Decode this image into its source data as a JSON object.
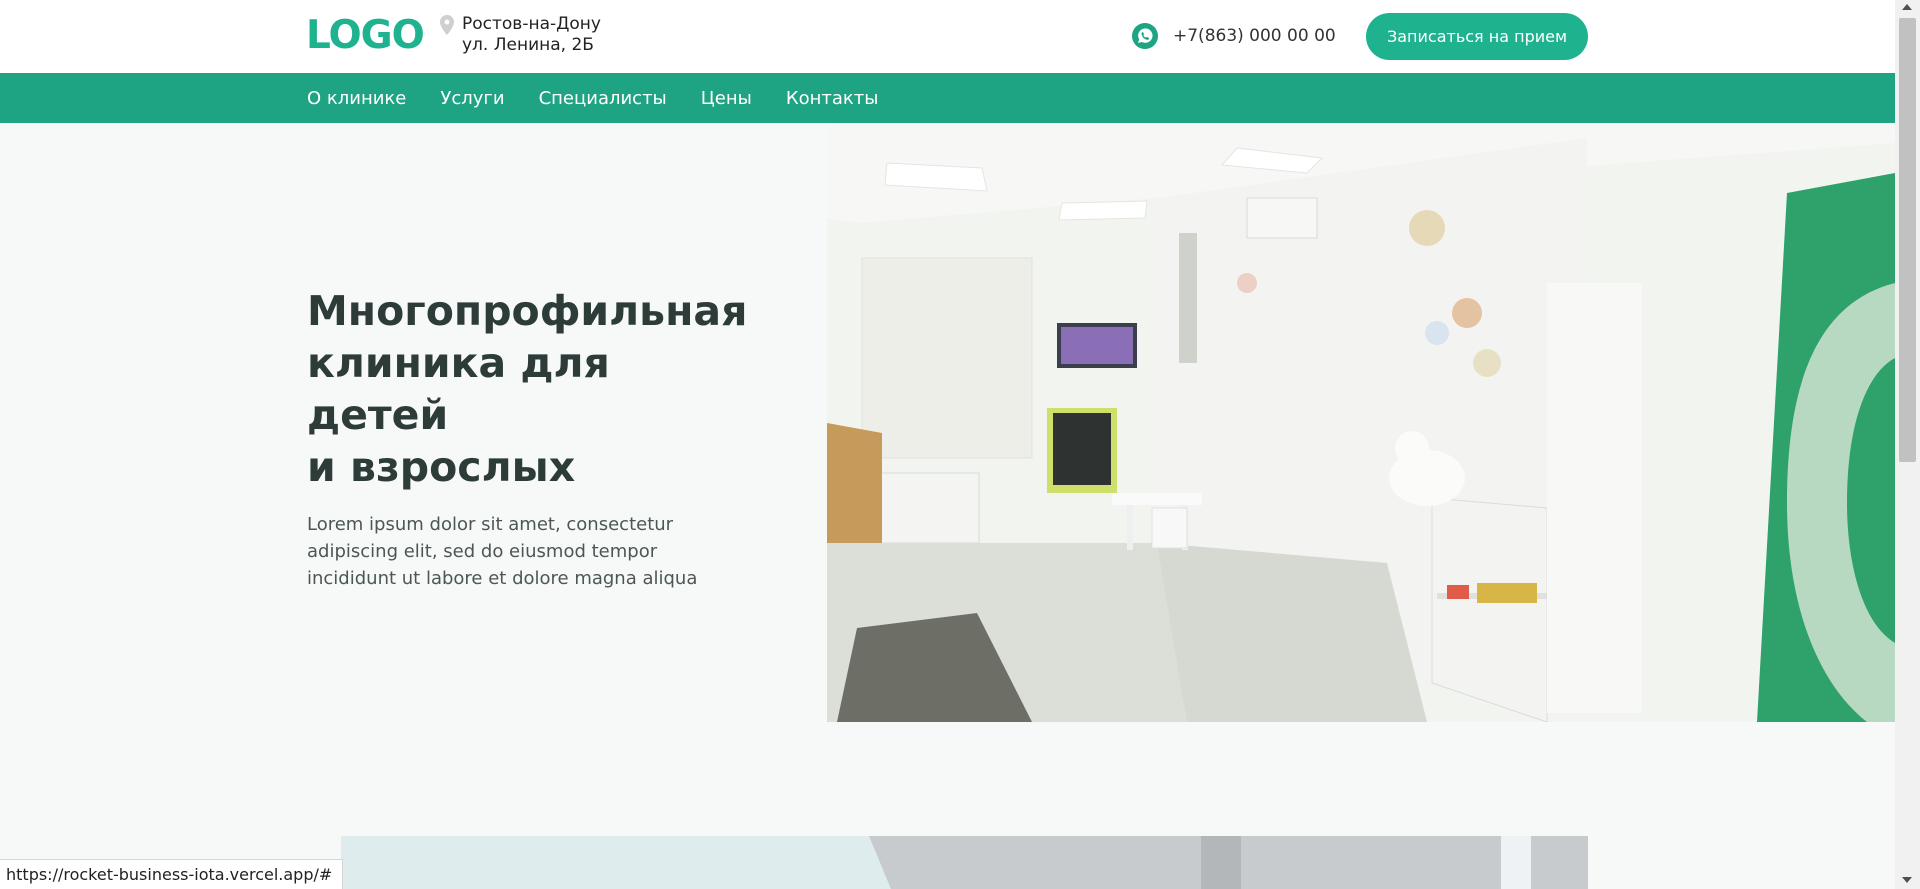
{
  "header": {
    "logo": "LOGO",
    "address_line1": "Ростов-на-Дону",
    "address_line2": "ул. Ленина, 2Б",
    "phone": "+7(863) 000 00 00",
    "cta_label": "Записаться на прием"
  },
  "nav": {
    "items": [
      {
        "label": "О клинике"
      },
      {
        "label": "Услуги"
      },
      {
        "label": "Специалисты"
      },
      {
        "label": "Цены"
      },
      {
        "label": "Контакты"
      }
    ]
  },
  "hero": {
    "title_line1": "Многопрофильная",
    "title_line2": "клиника для детей",
    "title_line3": "и взрослых",
    "desc_line1": "Lorem ipsum dolor sit amet, consectetur",
    "desc_line2": "adipiscing elit, sed do eiusmod tempor",
    "desc_line3": "incididunt ut labore et dolore magna aliqua"
  },
  "status_bar": {
    "url": "https://rocket-business-iota.vercel.app/#"
  },
  "colors": {
    "accent": "#1eb28f",
    "nav_bg": "#1ea383",
    "page_bg": "#f6f9f8"
  }
}
